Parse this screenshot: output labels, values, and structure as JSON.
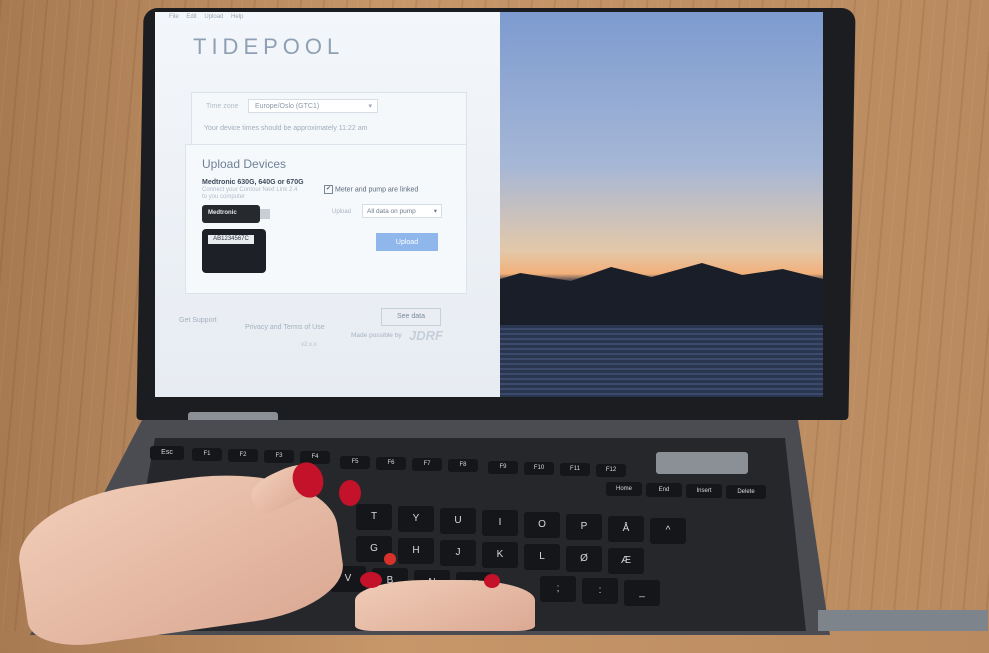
{
  "app": {
    "menu": [
      "File",
      "Edit",
      "Upload",
      "Help"
    ],
    "logo": "TIDEPOOL",
    "timezone": {
      "label": "Time zone",
      "value": "Europe/Oslo (GTC1)",
      "note": "Your device times should be approximately 11:22 am"
    },
    "upload_devices": {
      "title": "Upload Devices",
      "device_name": "Medtronic 630G, 640G or 670G",
      "device_sub1": "Connect your Contour Next Link 2.4",
      "device_sub2": "to you computer",
      "checkbox_label": "Meter and pump are linked",
      "upload_label": "Upload",
      "upload_select": "All data on pump",
      "upload_button": "Upload",
      "stick_label": "Medtronic",
      "pump_label": "AB1234567C"
    },
    "footer": {
      "get_support": "Get Support",
      "privacy": "Privacy and Terms of Use",
      "version": "v2.x.x",
      "see_data": "See data",
      "made_possible_by": "Made possible by",
      "jdrf": "JDRF"
    }
  },
  "keyboard": {
    "row1": [
      "Esc",
      "F1",
      "F2",
      "F3",
      "F4",
      "F5",
      "F6",
      "F7",
      "F8",
      "F9",
      "F10",
      "F11",
      "F12",
      "Home",
      "End",
      "Insert",
      "Delete"
    ],
    "row3": [
      "T",
      "Y",
      "U",
      "I",
      "O",
      "P",
      "Å",
      "^"
    ],
    "row4": [
      "G",
      "H",
      "J",
      "K",
      "L",
      "Ø",
      "Æ"
    ],
    "row5": [
      "V",
      "B",
      "N",
      "M",
      ";",
      ":",
      "_"
    ]
  },
  "colors": {
    "upload_button": "#8fb7ec",
    "trackpoint": "#d6312a",
    "nail_polish": "#c4122a"
  }
}
